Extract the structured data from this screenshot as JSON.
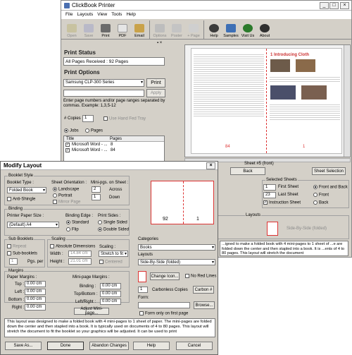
{
  "main": {
    "title": "ClickBook Printer",
    "menu": [
      "File",
      "Layouts",
      "View",
      "Tools",
      "Help"
    ],
    "toolbar": [
      {
        "label": "Open",
        "icon": "open-icon",
        "enabled": false
      },
      {
        "label": "Save",
        "icon": "save-icon",
        "enabled": false
      },
      {
        "label": "Print",
        "icon": "print-icon",
        "enabled": true
      },
      {
        "label": "PDF",
        "icon": "pdf-icon",
        "enabled": true
      },
      {
        "label": "Email",
        "icon": "email-icon",
        "enabled": true
      },
      {
        "label": "Options",
        "icon": "options-icon",
        "enabled": false
      },
      {
        "label": "Poster",
        "icon": "poster-icon",
        "enabled": false
      },
      {
        "label": "+ Page",
        "icon": "add-page-icon",
        "enabled": false
      },
      {
        "label": "Help",
        "icon": "help-icon",
        "enabled": true
      },
      {
        "label": "Samples",
        "icon": "samples-icon",
        "enabled": true
      },
      {
        "label": "Visit Us",
        "icon": "visit-us-icon",
        "enabled": true
      },
      {
        "label": "About",
        "icon": "about-icon",
        "enabled": true
      }
    ],
    "print_status": {
      "heading": "Print Status",
      "text": "All Pages Received : 92 Pages"
    },
    "print_options": {
      "heading": "Print Options",
      "printer": "Samsung CLP-300 Series",
      "print_label": "Print",
      "apply_label": "Apply",
      "hint": "Enter page numbers and/or page ranges separated by commas.  Example:  1,3,5-12",
      "copies_label": "# Copies",
      "copies": "1",
      "duplex_label": "Use Hand Fed Tray",
      "jobs_label": "Jobs",
      "pages_label": "Pages",
      "table_headers": [
        "Title",
        "Pages"
      ],
      "jobs": [
        {
          "title": "Microsoft Word - ...",
          "pages": "8"
        },
        {
          "title": "Microsoft Word - ...",
          "pages": "84"
        }
      ]
    },
    "preview": {
      "page_chapter": "1 Introducing Cloth",
      "left_page_no": "84",
      "right_page_no": "1",
      "sheet_label": "Sheet #5 (front)",
      "back_label": "Back",
      "selection_label": "Sheet Selection"
    },
    "selected_sheets": {
      "heading": "Selected Sheets",
      "first": "1",
      "first_label": "First Sheet",
      "last": "23",
      "last_label": "Last Sheet",
      "instruction_label": "Instruction Sheet",
      "front_back_label": "Front and Back",
      "front_label": "Front",
      "back_label": "Back"
    },
    "layouts": {
      "heading": "Layouts",
      "current": "Side-By-Side (folded)",
      "description": "...igned to make a folded book with 4 mini-pages to 1 sheet of ...e are folded down the center and then stapled into a book. It is ...ents of 4 to 80 pages.  This layout will stretch the document"
    }
  },
  "dialog": {
    "title": "Modify Layout",
    "booklet_style": {
      "heading": "Booklet Style",
      "type_label": "Booklet Type :",
      "type": "Folded Book",
      "anti_shingle": "Anti-Shingle",
      "orientation_label": "Sheet Orientation :",
      "landscape": "Landscape",
      "portrait": "Portrait",
      "mirror": "Mirror Page",
      "minipgs_label": "Mini-pgs. on Sheet :",
      "across": "2",
      "across_label": "Across",
      "down": "1",
      "down_label": "Down"
    },
    "binding": {
      "heading": "Binding",
      "paper_size_label": "Printer Paper Size :",
      "paper_size": "(Default) A4",
      "edge_label": "Binding Edge :",
      "standard": "Standard",
      "flip": "Flip",
      "sides_label": "Print Sides :",
      "single": "Single Sided",
      "double": "Double Sided"
    },
    "sub_booklets": {
      "heading": "Sub Booklets",
      "repeat": "Repeat",
      "sub": "Sub-booklets",
      "pgs": "1",
      "pgs_label": "Pgs. per"
    },
    "scaling": {
      "heading": "Scaling",
      "absolute": "Absolute Dimensions",
      "width_label": "Width :",
      "width": "14.84 cm",
      "height_label": "Height :",
      "height": "21.01 cm",
      "scaling_label": "Scaling :",
      "mode": "Stretch to fit",
      "centered": "Centered"
    },
    "preview": {
      "left": "92",
      "right": "1"
    },
    "categories_label": "Categories",
    "category": "Books",
    "layouts_label": "Layouts",
    "layout": "Side-By-Side (folded)",
    "margins": {
      "heading": "Margins",
      "paper_label": "Paper Margins :",
      "top_label": "Top :",
      "top": "0.00 cm",
      "left_label": "Left :",
      "left": "0.00 cm",
      "bottom_label": "Bottom :",
      "bottom": "0.00 cm",
      "right_label": "Right :",
      "right": "0.00 cm",
      "mini_label": "Mini-page Margins :",
      "binding_label": "Binding :",
      "binding": "0.00 cm",
      "tb_label": "Top/Bottom :",
      "tb": "0.00 cm",
      "lr_label": "Left/Right :",
      "lr": "0.00 cm",
      "adjust_label": "Adjust Mini-page..."
    },
    "icon": {
      "change": "Change Icon...",
      "no_red": "No Red Lines"
    },
    "carbonless": {
      "count": "1",
      "label": "Carbonless Copies",
      "button": "Carbon #"
    },
    "form": {
      "label": "Form:",
      "browse": "Browse...",
      "first_only": "Form only on first page"
    },
    "description": "This layout was designed to make a folded book with 4 mini-pages to 1 sheet of paper.  The mini-pages are folded down the center and then stapled into a book.  It is typically used on documents of 4 to 80 pages.  This layout will stretch the document to fit the booklet so your graphics will be adjusted.  It can be used to print",
    "buttons": [
      "Save As...",
      "Done",
      "Abandon Changes",
      "Help",
      "Cancel"
    ]
  }
}
